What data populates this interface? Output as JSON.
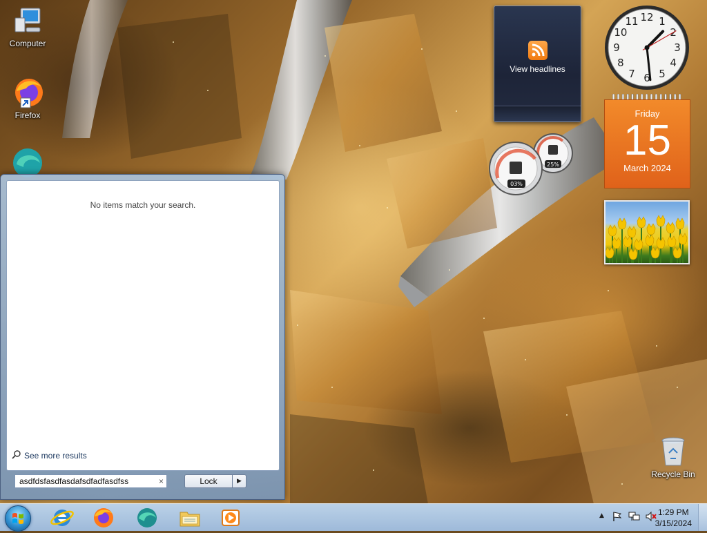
{
  "desktop": {
    "icons": [
      {
        "label": "Computer",
        "icon": "computer-icon"
      },
      {
        "label": "Firefox",
        "icon": "firefox-icon"
      },
      {
        "label": "",
        "icon": "edge-icon"
      },
      {
        "label": "Recycle Bin",
        "icon": "recycle-bin-icon"
      }
    ]
  },
  "gadgets": {
    "feed": {
      "label": "View headlines"
    },
    "clock": {
      "hour": 1,
      "minute": 29,
      "second": 10
    },
    "calendar": {
      "weekday": "Friday",
      "day": "15",
      "month": "March 2024"
    },
    "cpu_meter": {
      "cpu": "03%",
      "memory": "25%"
    },
    "slideshow": {
      "subject": "yellow tulips"
    }
  },
  "start_menu": {
    "no_results": "No items match your search.",
    "see_more": "See more results",
    "search_value": "asdfdsfasdfasdafsdfadfasdfss",
    "clear_glyph": "×",
    "power_button": "Lock",
    "power_arrow": "▶"
  },
  "taskbar": {
    "pinned": [
      "internet-explorer-icon",
      "firefox-icon",
      "edge-icon",
      "file-explorer-icon",
      "media-player-icon"
    ],
    "tray": {
      "time": "1:29 PM",
      "date": "3/15/2024",
      "show_hidden": "▲"
    }
  },
  "colors": {
    "calendar_orange": "#e0621a",
    "feed_bg": "#1d2438",
    "taskbar_blue": "#a8c4e4"
  }
}
